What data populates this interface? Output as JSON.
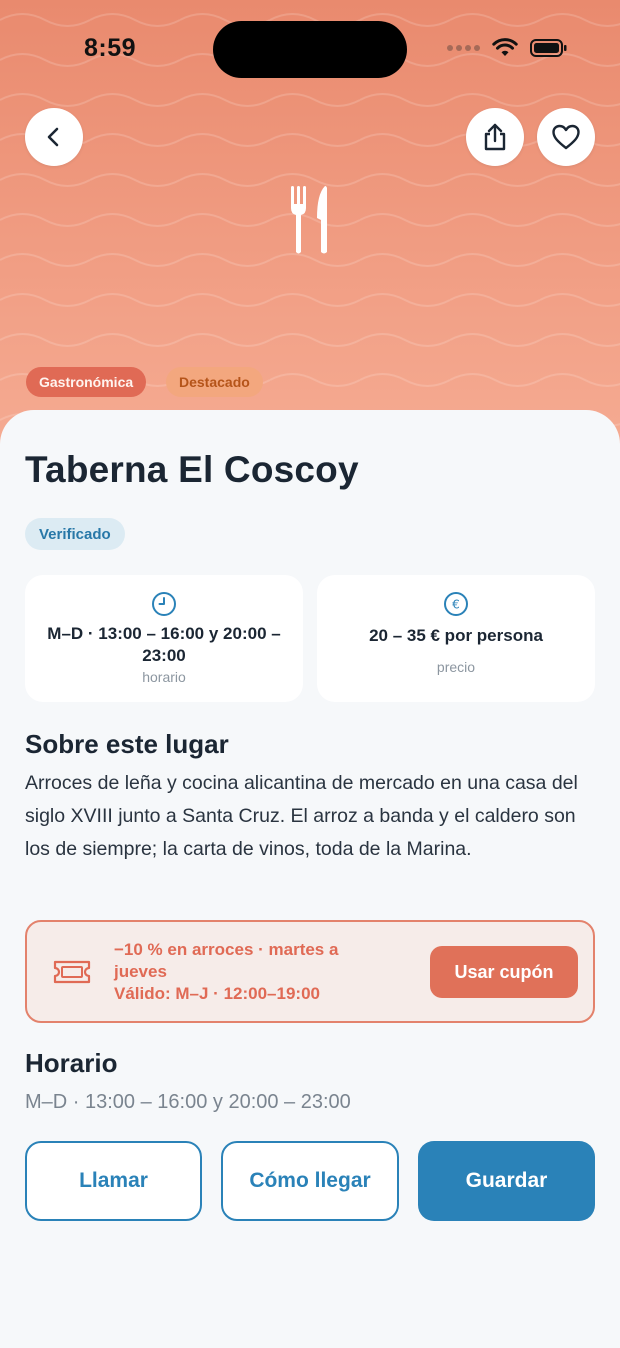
{
  "status_bar": {
    "time": "8:59"
  },
  "hero": {
    "icon": "fork-knife-icon",
    "tags": {
      "category": "Gastronómica",
      "featured": "Destacado"
    },
    "colors": {
      "top": "#e98a6e",
      "bottom": "#f5ab92"
    }
  },
  "place": {
    "name": "Taberna El Coscoy",
    "badge": "Verificado",
    "hours_card": {
      "value": "M–D · 13:00 – 16:00 y 20:00 – 23:00",
      "label": "horario"
    },
    "price_card": {
      "value": "20 – 35 € por persona",
      "label": "precio"
    }
  },
  "about": {
    "title": "Sobre este lugar",
    "text": "Arroces de leña y cocina alicantina de mercado en una casa del siglo XVIII junto a Santa Cruz. El arroz a banda y el caldero son los de siempre; la carta de vinos, toda de la Marina."
  },
  "coupon": {
    "offer": "−10 % en arroces · martes a jueves",
    "validity": "Válido: M–J · 12:00–19:00",
    "button": "Usar cupón"
  },
  "schedule": {
    "title": "Horario",
    "text": "M–D · 13:00 – 16:00 y 20:00 – 23:00"
  },
  "actions": {
    "call": "Llamar",
    "directions": "Cómo llegar",
    "save": "Guardar"
  },
  "colors": {
    "accent": "#2a82b8",
    "coupon": "#e06a55",
    "text": "#1b2633"
  }
}
